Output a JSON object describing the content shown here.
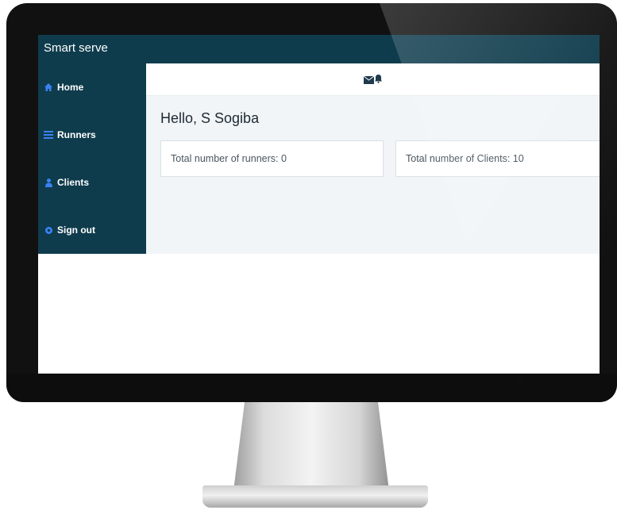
{
  "app": {
    "title": "Smart serve"
  },
  "sidebar": {
    "items": [
      {
        "label": "Home",
        "icon": "home-icon"
      },
      {
        "label": "Runners",
        "icon": "list-icon"
      },
      {
        "label": "Clients",
        "icon": "user-icon"
      },
      {
        "label": "Sign out",
        "icon": "gear-icon"
      }
    ]
  },
  "header": {
    "icons": [
      "envelope-icon",
      "bell-icon"
    ]
  },
  "main": {
    "greeting": "Hello, S Sogiba",
    "cards": [
      {
        "text": "Total number of runners: 0"
      },
      {
        "text": "Total number of Clients: 10"
      }
    ]
  },
  "colors": {
    "sidebar_bg": "#0f3c4d",
    "content_bg": "#f1f5f8",
    "icon_accent": "#3b82f6"
  }
}
